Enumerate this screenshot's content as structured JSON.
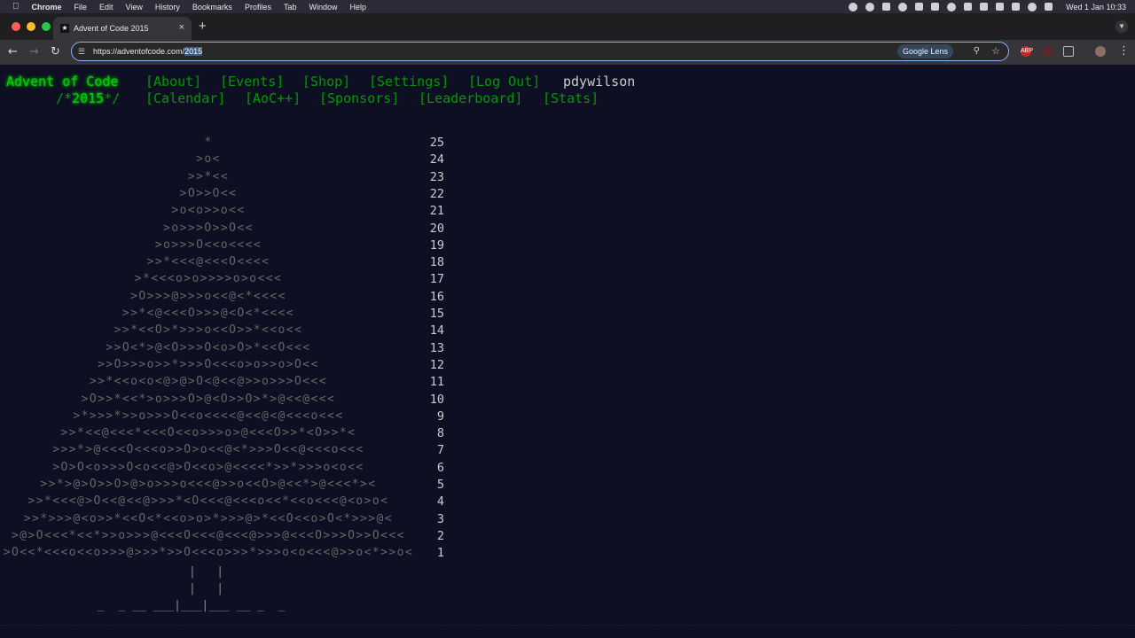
{
  "menubar": {
    "app_name": "Chrome",
    "items": [
      "File",
      "Edit",
      "View",
      "History",
      "Bookmarks",
      "Profiles",
      "Tab",
      "Window",
      "Help"
    ],
    "clock": "Wed 1 Jan  10:33"
  },
  "browser": {
    "tab_title": "Advent of Code 2015",
    "new_tab": "+",
    "url_prefix": "https://adventofcode.com/",
    "url_selected": "2015",
    "lens_label": "Google Lens"
  },
  "site": {
    "title": "Advent of Code",
    "year_prefix": "/*",
    "year": "2015",
    "year_suffix": "*/",
    "nav1": [
      "[About]",
      "[Events]",
      "[Shop]",
      "[Settings]",
      "[Log Out]"
    ],
    "user": "pdywilson",
    "nav2": [
      "[Calendar]",
      "[AoC++]",
      "[Sponsors]",
      "[Leaderboard]",
      "[Stats]"
    ]
  },
  "calendar": {
    "rows": [
      {
        "art": "*",
        "day": "25"
      },
      {
        "art": ">o<",
        "day": "24"
      },
      {
        "art": ">>*<<",
        "day": "23"
      },
      {
        "art": ">O>>O<<",
        "day": "22"
      },
      {
        "art": ">o<o>>o<<",
        "day": "21"
      },
      {
        "art": ">o>>>O>>O<<",
        "day": "20"
      },
      {
        "art": ">o>>>O<<o<<<<",
        "day": "19"
      },
      {
        "art": ">>*<<<@<<<O<<<<",
        "day": "18"
      },
      {
        "art": ">*<<<o>o>>>>o>o<<<",
        "day": "17"
      },
      {
        "art": ">O>>>@>>>o<<@<*<<<<",
        "day": "16"
      },
      {
        "art": ">>*<@<<<O>>>@<O<*<<<<",
        "day": "15"
      },
      {
        "art": ">>*<<O>*>>>o<<O>>*<<o<<",
        "day": "14"
      },
      {
        "art": ">>O<*>@<O>>>O<o>O>*<<O<<<",
        "day": "13"
      },
      {
        "art": ">>O>>>o>>*>>>O<<<o>o>>o>O<<",
        "day": "12"
      },
      {
        "art": ">>*<<o<o<@>@>O<@<<@>>o>>>O<<<",
        "day": "11"
      },
      {
        "art": ">O>>*<<*>o>>>O>@<O>>O>*>@<<@<<<",
        "day": "10"
      },
      {
        "art": ">*>>>*>>o>>>O<<o<<<<@<<@<@<<<o<<<",
        "day": "9"
      },
      {
        "art": ">>*<<@<<<*<<<O<<o>>>o>@<<<O>>*<O>>*<",
        "day": "8"
      },
      {
        "art": ">>>*>@<<<O<<<o>>O>o<<@<*>>>O<<@<<<o<<<",
        "day": "7"
      },
      {
        "art": ">O>O<o>>>O<o<<@>O<<o>@<<<<*>>*>>>o<o<<",
        "day": "6"
      },
      {
        "art": ">>*>@>O>>O>@>o>>>o<<<@>>o<<O>@<<*>@<<<*><",
        "day": "5"
      },
      {
        "art": ">>*<<<@>O<<@<<@>>>*<O<<<@<<<o<<*<<o<<<@<o>o<",
        "day": "4"
      },
      {
        "art": ">>*>>>@<o>>*<<O<*<<o>o>*>>>@>*<<O<<o>O<*>>>@<",
        "day": "3"
      },
      {
        "art": ">@>O<<<*<<*>>o>>>@<<<O<<<@<<<@>>>@<<<O>>>O>>O<<<",
        "day": "2"
      },
      {
        "art": ">O<<*<<<o<<o>>>@>>>*>>O<<<o>>>*>>>o<o<<<@>>o<*>>o<",
        "day": "1"
      }
    ],
    "trunk": [
      "|   |",
      "|   |",
      "_  _ __ ___|___|___ __ _  _"
    ]
  }
}
